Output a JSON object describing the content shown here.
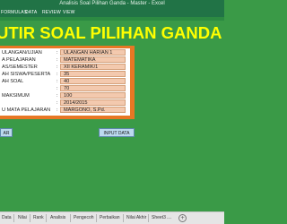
{
  "window": {
    "title": "Analisis Soal Pilihan Ganda - Master - Excel"
  },
  "ribbon": {
    "tabs": [
      "FORMULAS",
      "DATA",
      "REVIEW",
      "VIEW"
    ]
  },
  "header": {
    "title": "UTIR SOAL PILIHAN GANDA"
  },
  "form": {
    "rows": [
      {
        "label": "ULANGAN/UJIAN",
        "value": "ULANGAN HARIAN 1"
      },
      {
        "label": "A PELAJARAN",
        "value": "MATEMATIKA"
      },
      {
        "label": "AS/SEMESTER",
        "value": "XII KERAMIK/1"
      },
      {
        "label": "AH SISWA/PESERTA",
        "value": "35"
      },
      {
        "label": "AH SOAL",
        "value": "40"
      },
      {
        "label": "",
        "value": "70"
      },
      {
        "label": "MAKSIMUM",
        "value": "100"
      },
      {
        "label": "",
        "value": "2014/2015"
      },
      {
        "label": "U MATA PELAJARAN",
        "value": "MARGONO, S.Pd."
      }
    ]
  },
  "buttons": {
    "left": "AR",
    "input": "INPUT DATA"
  },
  "sheet_tabs": [
    "Data",
    "Nilai",
    "Rank",
    "Analisis",
    "Pengecoh",
    "Perbaikan",
    "Nilai Akhir",
    "Sheet3"
  ],
  "sheet_tabs_more": "...",
  "add_sheet": "+"
}
